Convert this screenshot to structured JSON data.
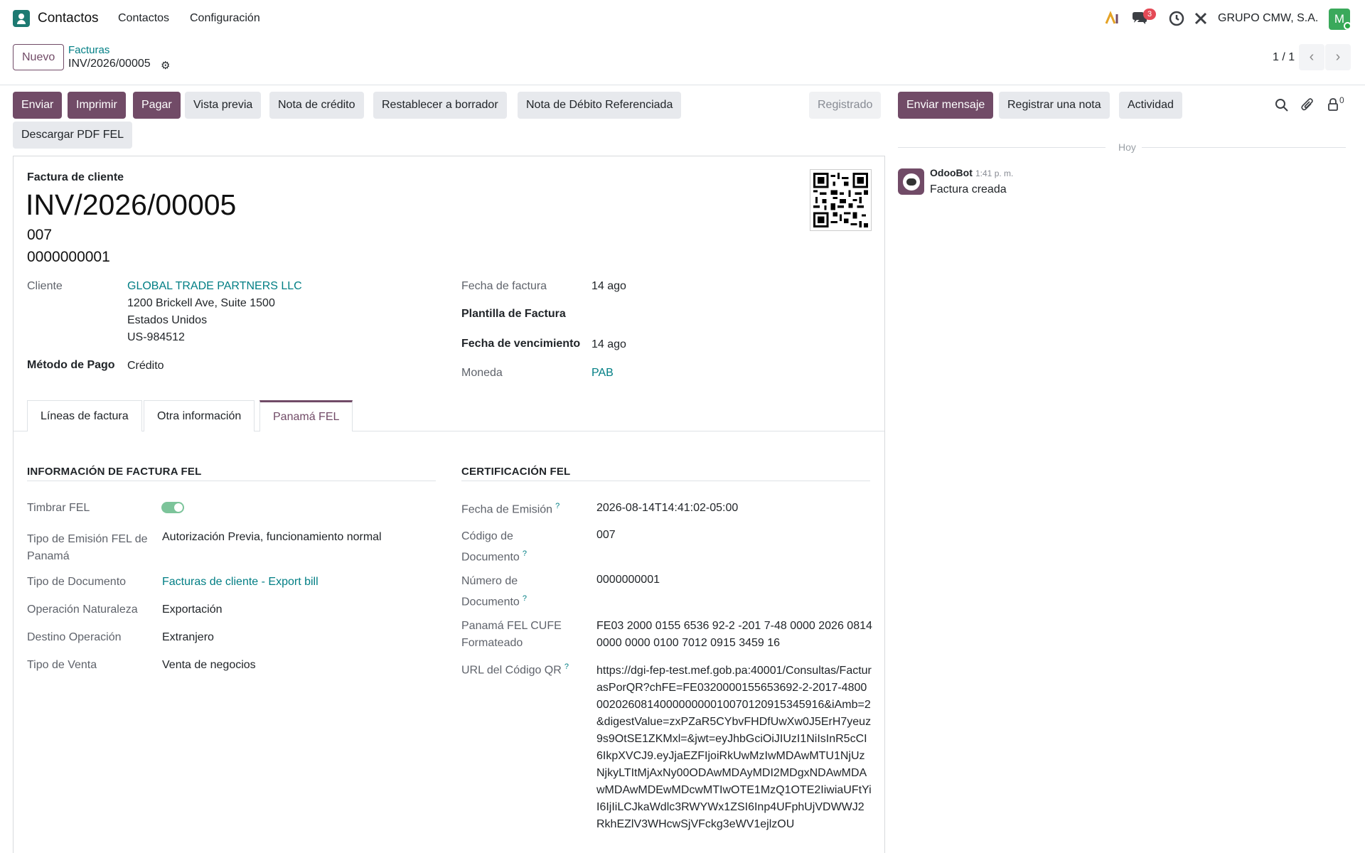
{
  "navbar": {
    "app_name": "Contactos",
    "menus": [
      "Contactos",
      "Configuración"
    ],
    "chat_badge": "3",
    "company": "GRUPO CMW, S.A.",
    "avatar_letter": "M"
  },
  "control_panel": {
    "new_label": "Nuevo",
    "breadcrumb_parent": "Facturas",
    "breadcrumb_current": "INV/2026/00005",
    "pager": "1 / 1"
  },
  "actions": {
    "send": "Enviar",
    "print": "Imprimir",
    "pay": "Pagar",
    "preview": "Vista previa",
    "credit_note": "Nota de crédito",
    "reset_draft": "Restablecer a borrador",
    "debit_note": "Nota de Débito Referenciada",
    "download_pdf": "Descargar PDF FEL",
    "status": "Registrado"
  },
  "chatter": {
    "send_message": "Enviar mensaje",
    "log_note": "Registrar una nota",
    "activity": "Actividad",
    "followers_count": "0",
    "today": "Hoy",
    "message": {
      "author": "OdooBot",
      "time": "1:41 p. m.",
      "body": "Factura creada"
    }
  },
  "invoice": {
    "type": "Factura de cliente",
    "name": "INV/2026/00005",
    "line1": "007",
    "line2": "0000000001",
    "customer_label": "Cliente",
    "customer_name": "GLOBAL TRADE PARTNERS LLC",
    "customer_address": [
      "1200 Brickell Ave, Suite 1500",
      "Estados Unidos",
      "US-984512"
    ],
    "payment_method_label": "Método de Pago",
    "payment_method": "Crédito",
    "invoice_date_label": "Fecha de factura",
    "invoice_date": "14 ago",
    "template_label": "Plantilla de Factura",
    "due_date_label": "Fecha de vencimiento",
    "due_date": "14 ago",
    "currency_label": "Moneda",
    "currency": "PAB"
  },
  "tabs": [
    "Líneas de factura",
    "Otra información",
    "Panamá FEL"
  ],
  "fel_info": {
    "title": "INFORMACIÓN DE FACTURA FEL",
    "stamp_label": "Timbrar FEL",
    "stamp_on": true,
    "emission_type_label": "Tipo de Emisión FEL de Panamá",
    "emission_type": "Autorización Previa, funcionamiento normal",
    "doc_type_label": "Tipo de Documento",
    "doc_type": "Facturas de cliente - Export bill",
    "nature_label": "Operación Naturaleza",
    "nature": "Exportación",
    "destination_label": "Destino Operación",
    "destination": "Extranjero",
    "sale_type_label": "Tipo de Venta",
    "sale_type": "Venta de negocios"
  },
  "fel_cert": {
    "title": "CERTIFICACIÓN FEL",
    "emission_date_label": "Fecha de Emisión",
    "emission_date": "2026-08-14T14:41:02-05:00",
    "doc_code_label": "Código de Documento",
    "doc_code": "007",
    "doc_number_label": "Número de Documento",
    "doc_number": "0000000001",
    "cufe_label": "Panamá FEL CUFE Formateado",
    "cufe": "FE03 2000 0155 6536 92-2 -201 7-48 0000 2026 0814 0000 0000 0100 7012 0915 3459 16",
    "qr_url_label": "URL del Código QR",
    "qr_url": "https://dgi-fep-test.mef.gob.pa:40001/Consultas/FacturasPorQR?chFE=FE0320000155653692-2-2017-4800002026081400000000010070120915345916&iAmb=2&digestValue=zxPZaR5CYbvFHDfUwXw0J5ErH7yeuz9s9OtSE1ZKMxl=&jwt=eyJhbGciOiJIUzI1NiIsInR5cCI6IkpXVCJ9.eyJjaEZFIjoiRkUwMzIwMDAwMTU1NjUzNjkyLTItMjAxNy00ODAwMDAyMDI2MDgxNDAwMDAwMDAwMDEwMDcwMTIwOTE1MzQ1OTE2IiwiaUFtYiI6IjIiLCJkaWdlc3RWYWx1ZSI6Inp4UFphUjVDWWJ2RkhEZlV3WHcwSjVFckg3eWV1ejlzOU"
  }
}
